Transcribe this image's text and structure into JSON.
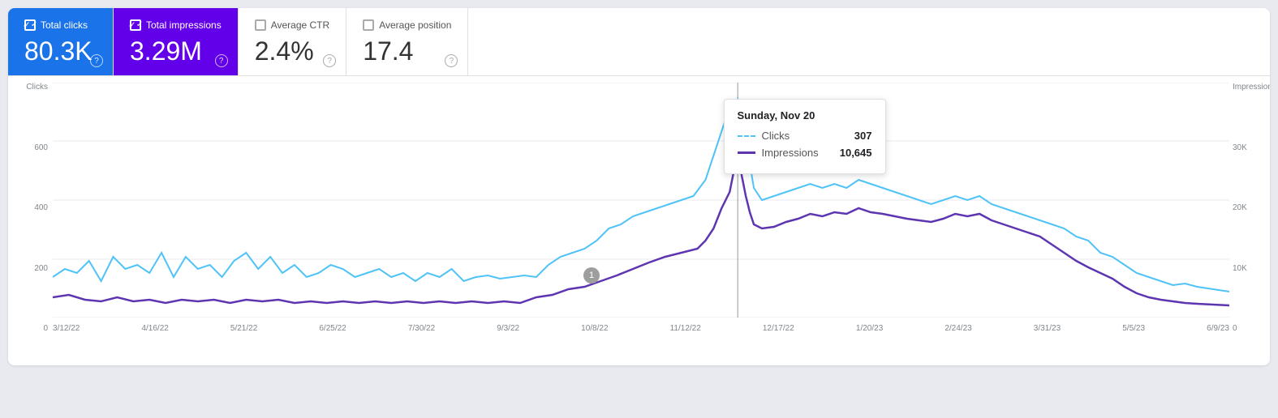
{
  "metrics": [
    {
      "id": "total-clicks",
      "label": "Total clicks",
      "value": "80.3K",
      "active": true,
      "style": "active-blue",
      "checked": true
    },
    {
      "id": "total-impressions",
      "label": "Total impressions",
      "value": "3.29M",
      "active": true,
      "style": "active-purple",
      "checked": true
    },
    {
      "id": "average-ctr",
      "label": "Average CTR",
      "value": "2.4%",
      "active": false,
      "style": "inactive",
      "checked": false
    },
    {
      "id": "average-position",
      "label": "Average position",
      "value": "17.4",
      "active": false,
      "style": "inactive",
      "checked": false
    }
  ],
  "chart": {
    "y_left_title": "Clicks",
    "y_right_title": "Impressions",
    "y_left_labels": [
      "600",
      "400",
      "200",
      "0"
    ],
    "y_right_labels": [
      "30K",
      "20K",
      "10K",
      "0"
    ],
    "x_labels": [
      "3/12/22",
      "4/16/22",
      "5/21/22",
      "6/25/22",
      "7/30/22",
      "9/3/22",
      "10/8/22",
      "11/12/22",
      "12/17/22",
      "1/20/23",
      "2/24/23",
      "3/31/23",
      "5/5/23",
      "6/9/23"
    ]
  },
  "tooltip": {
    "date": "Sunday, Nov 20",
    "rows": [
      {
        "metric": "Clicks",
        "value": "307",
        "type": "blue-dashed"
      },
      {
        "metric": "Impressions",
        "value": "10,645",
        "type": "purple-solid"
      }
    ]
  },
  "annotation": {
    "label": "1"
  }
}
